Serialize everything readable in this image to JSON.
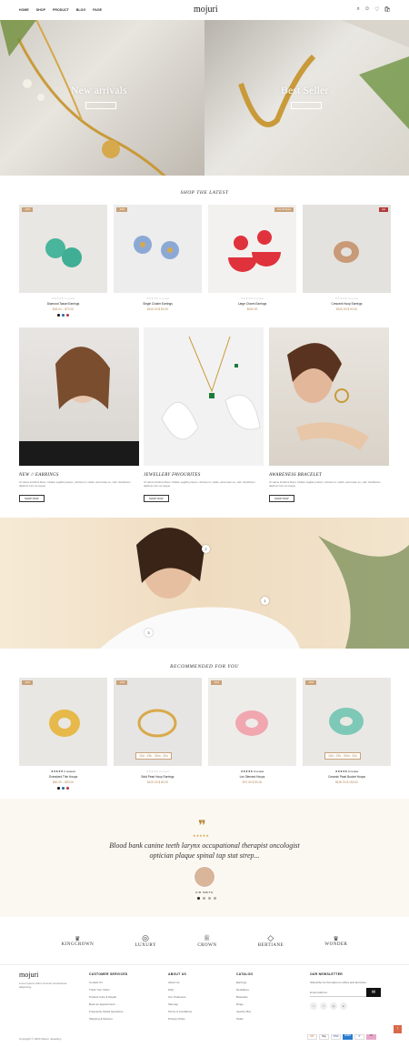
{
  "nav": {
    "menu": [
      "HOME",
      "SHOP",
      "PRODUCT",
      "BLOG",
      "PAGE"
    ],
    "logo": "mojuri"
  },
  "hero": {
    "left_title": "New arrivals",
    "right_title": "Best Seller"
  },
  "shop_latest": {
    "title": "SHOP THE LATEST",
    "products": [
      {
        "badge": "-22%",
        "badge_color": "#c9a27a",
        "name": "Diamond Tassel Earrings",
        "price": "$45.00 – $70.00",
        "reviews": "0 review",
        "bg": "#e9e7e3"
      },
      {
        "badge": "-13%",
        "badge_color": "#c9a27a",
        "name": "Single Cluster Earrings",
        "price": "$100.00 $ 80.00",
        "reviews": "0 review",
        "bg": "#ededed"
      },
      {
        "badge": "Out Of Stock",
        "badge_color": "#c9a27a",
        "name": "Large Charm Earrings",
        "price": "$250.00",
        "reviews": "0 review",
        "bg": "#f2f1ef"
      },
      {
        "badge": "Hot",
        "badge_color": "#b33a3a",
        "name": "Crescent Hoop Earrings",
        "price": "$100.00 $ 90.00",
        "reviews": "0 review",
        "bg": "#e4e2de"
      }
    ]
  },
  "features": [
    {
      "title": "NEW // EARRINGS",
      "desc": "Ut varius tincidunt libero. Nullam sagittis pretium, ultricies id, mattis, accumsan eu, velit. Vestibulum dapibus nunc ac augue.",
      "button": "SHOP NOW"
    },
    {
      "title": "JEWELLERY FAVOURITES",
      "desc": "Ut varius tincidunt libero. Nullam sagittis pretium, ultricies id, mattis, accumsan eu, velit. Vestibulum dapibus nunc ac augue.",
      "button": "SHOP NOW"
    },
    {
      "title": "AWARENESS BRACELET",
      "desc": "Ut varius tincidunt libero. Nullam sagittis pretium, ultricies id, mattis, accumsan eu, velit. Vestibulum dapibus nunc ac augue.",
      "button": "SHOP NOW"
    }
  ],
  "hotspots": [
    "1",
    "2",
    "3"
  ],
  "recommended": {
    "title": "RECOMMENDED FOR YOU",
    "products": [
      {
        "badge": "-22%",
        "badge_color": "#c9a27a",
        "name": "Oversized Thin Hoops",
        "price": "$50.00 – $90.00",
        "reviews": "2 reviews",
        "bg": "#e8e7e4",
        "countdown": ""
      },
      {
        "badge": "-13%",
        "badge_color": "#c9a27a",
        "name": "Bold Pearl Hoop Earrings",
        "price": "$100.00 $ 80.00",
        "reviews": "0 review",
        "bg": "#e6e5e3",
        "countdown": "15d : 23h : 30m : 32s"
      },
      {
        "badge": "-16%",
        "badge_color": "#c9a27a",
        "name": "Lex Sleeved Hoops",
        "price": "$70.00 $ 50.00",
        "reviews": "0 review",
        "bg": "#eeece9",
        "countdown": ""
      },
      {
        "badge": "-18%",
        "badge_color": "#c9a27a",
        "name": "Ceramic Pearl Bucket Hoops",
        "price": "$190.00 $ 150.00",
        "reviews": "0 review",
        "bg": "#eae8e4",
        "countdown": "15d : 23h : 30m : 32s"
      }
    ]
  },
  "testimonial": {
    "quote_line1": "Blood bank canine teeth larynx occupational therapist oncologist",
    "quote_line2": "optician plaque spinal tap stat strep...",
    "author": "KIR SMITH"
  },
  "brands": [
    "KINGCROWN",
    "LUXURY",
    "CROWN",
    "BERTIANE",
    "WONDER"
  ],
  "footer": {
    "logo": "mojuri",
    "about": "Lorem ipsum dolor sit amet consectetur adipiscing",
    "columns": [
      {
        "title": "CUSTOMER SERVICES",
        "items": [
          "Contact Us",
          "Track Your Order",
          "Product Care & Repair",
          "Book an Appointment",
          "Frequently Asked Questions",
          "Shipping & Returns"
        ]
      },
      {
        "title": "ABOUT US",
        "items": [
          "About Us",
          "FAQ",
          "Our Producers",
          "Sitemap",
          "Terms & Conditions",
          "Privacy Policy"
        ]
      },
      {
        "title": "CATALOG",
        "items": [
          "Earrings",
          "Necklaces",
          "Bracelets",
          "Rings",
          "Jewelry Box",
          "Studs"
        ]
      }
    ],
    "newsletter_title": "OUR NEWSLETTER",
    "newsletter_text": "Subscribe for the latest on offers and launches",
    "email_placeholder": "Email address",
    "copyright": "Copyright © 2023 Mojuri. Jewellery",
    "payments": [
      "MC",
      "Pay",
      "VISA",
      "AMEX",
      "P",
      "Kl"
    ]
  }
}
